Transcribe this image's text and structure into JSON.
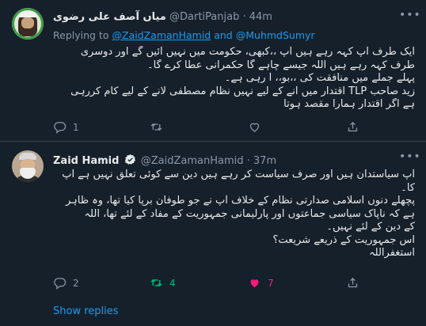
{
  "tweets": [
    {
      "name": "میاں آصف علی رضوی",
      "handle": "@DartiPanjab",
      "separator": "·",
      "time": "44m",
      "replying_prefix": "Replying to",
      "replying_user1": "@ZaidZamanHamid",
      "replying_and": "and",
      "replying_user2": "@MuhmdSumyr",
      "lines": [
        "ایک طرف آپ کہہ رہے ہیں آپ ،،کبھی، حکومت میں نہیں آئیں گے اور دوسری",
        "طرف کہہ رہے ہیں اللہ جیسے چاہے گا حکمرانی عطا کرے گا۔",
        "پہلے جملے میں منافقت کی ،،بو،، آ رہی ہے۔",
        "زید صاحب TLP اقتدار میں آنے کے لیے نہیں نظام مصطفی لانے کے لیے کام کررہی",
        "ہے اگر اقتدار ہمارا مقصد ہوتا"
      ],
      "reply_count": "1",
      "retweet_count": "",
      "like_count": ""
    },
    {
      "name": "Zaid Hamid",
      "handle": "@ZaidZamanHamid",
      "separator": "·",
      "time": "37m",
      "lines": [
        "آپ سیاستدان ہیں اور صرف سیاست کر رہے ہیں دین سے کوئی تعلق نہیں ہے آپ",
        "کا۔",
        "پچھلے دنوں اسلامی صدارتی نظام کے خلاف آپ نے جو طوفان برپا کیا تھا، وہ ظاہر",
        "ہے کہ ناپاک سیاسی جماعتوں اور پارلیمانی جمہوریت کے مفاد کے لئے تھا، اللہ",
        "کے دین کے لئے نہیں۔",
        "اس جمہوریت کے ذریعے شریعت؟",
        "استغفراللہ"
      ],
      "reply_count": "2",
      "retweet_count": "4",
      "like_count": "7"
    }
  ],
  "show_replies": "Show replies",
  "icons": {
    "more": "more-horizontal-icon",
    "verified": "verified-badge-icon",
    "reply": "reply-icon",
    "retweet": "retweet-icon",
    "like": "heart-icon",
    "share": "share-icon"
  },
  "colors": {
    "background": "#15202b",
    "text": "#e7e9ea",
    "muted": "#8b98a5",
    "link": "#1d9bf0",
    "retweeted": "#00ba7c",
    "liked": "#f91880"
  }
}
